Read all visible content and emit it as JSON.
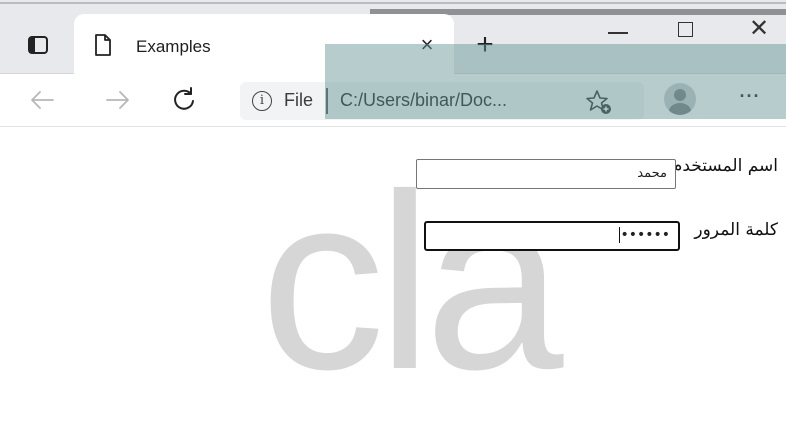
{
  "browser": {
    "tab": {
      "title": "Examples",
      "close_glyph": "×",
      "icon": "document-icon"
    },
    "new_tab_glyph": "+",
    "window_controls": {
      "minimize": "minimize-icon",
      "maximize": "maximize-icon",
      "close_glyph": "✕"
    },
    "toolbar": {
      "back": "back-arrow-icon",
      "forward": "forward-arrow-icon",
      "refresh": "refresh-icon",
      "info_glyph": "i",
      "url_scheme": "File",
      "url": "C:/Users/binar/Doc...",
      "favorites": "add-favorite-icon",
      "profile": "profile-icon",
      "more_glyph": "···"
    }
  },
  "page": {
    "watermark": "cla",
    "form": {
      "username_label": "اسم المستخدم",
      "username_value": "محمد",
      "password_label": "كلمة المرور",
      "password_value": "••••••"
    }
  }
}
